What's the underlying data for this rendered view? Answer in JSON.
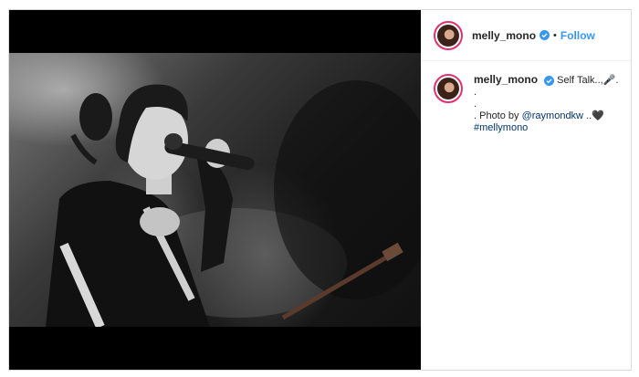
{
  "post": {
    "username": "melly_mono",
    "separator": "•",
    "follow_label": "Follow",
    "caption": {
      "username": "melly_mono",
      "text_first": "Self Talk..,🎤.",
      "line2": ".",
      "line3": ".",
      "line4_prefix": ". Photo by ",
      "mention": "@raymondkw",
      "line4_suffix": " ..🖤",
      "hashtag": "#mellymono"
    }
  },
  "colors": {
    "accent": "#3897f0",
    "verified": "#3897f0",
    "avatar_ring": "#e1306c",
    "link": "#003569"
  },
  "icons": {
    "verified": "verified-badge-icon",
    "microphone": "microphone-emoji",
    "heart": "black-heart-emoji"
  }
}
